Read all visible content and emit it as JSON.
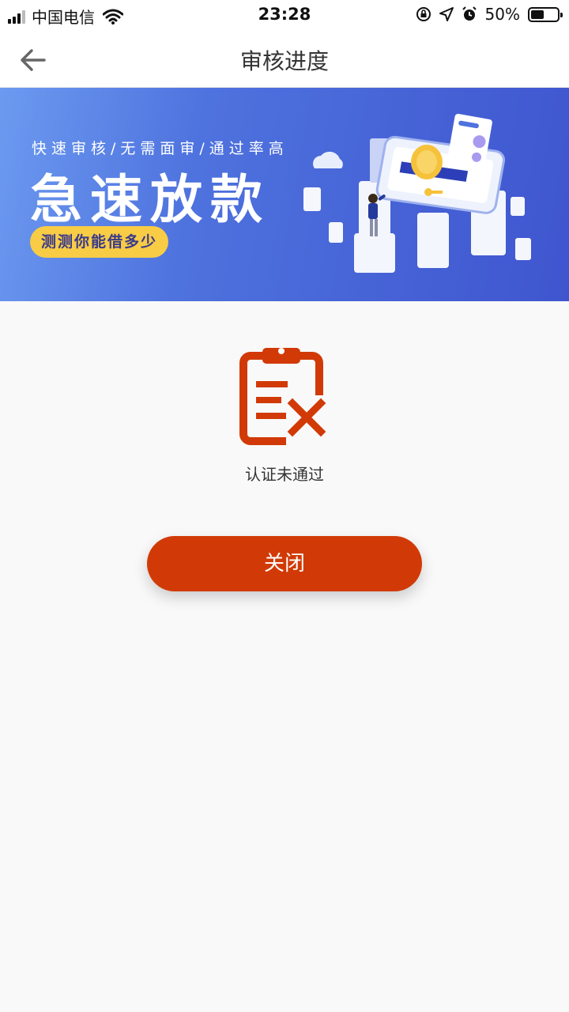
{
  "status_bar": {
    "carrier": "中国电信",
    "time": "23:28",
    "battery": "50%",
    "battery_level": 0.5
  },
  "nav": {
    "title": "审核进度",
    "back_icon": "arrow-left-icon"
  },
  "banner": {
    "tagline": "快速审核/无需面审/通过率高",
    "title": "急速放款",
    "button_label": "测测你能借多少"
  },
  "result": {
    "icon": "clipboard-reject-icon",
    "text": "认证未通过"
  },
  "actions": {
    "close_label": "关闭"
  },
  "colors": {
    "accent": "#d13a06",
    "banner_blue": "#4e72de",
    "banner_button": "#f8cc45"
  }
}
